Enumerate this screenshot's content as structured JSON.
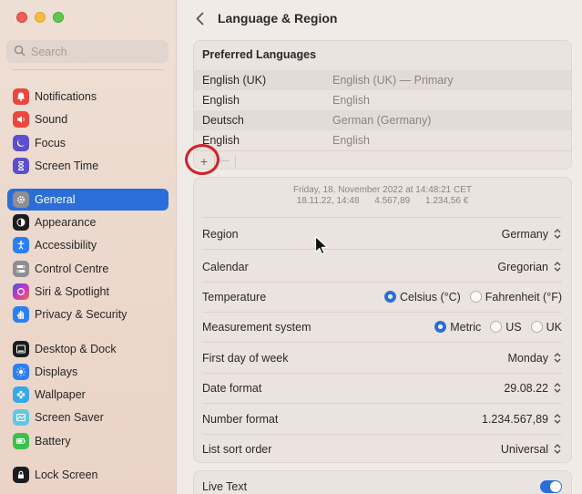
{
  "window": {
    "controls": [
      "close",
      "minimize",
      "zoom"
    ]
  },
  "search": {
    "placeholder": "Search"
  },
  "sidebar": {
    "items": [
      {
        "label": "Notifications",
        "icon": "bell-icon",
        "color": "#e9473f"
      },
      {
        "label": "Sound",
        "icon": "speaker-icon",
        "color": "#e9473f"
      },
      {
        "label": "Focus",
        "icon": "moon-icon",
        "color": "#5b4fcf"
      },
      {
        "label": "Screen Time",
        "icon": "hourglass-icon",
        "color": "#5b4fcf"
      },
      {
        "label": "General",
        "icon": "gear-icon",
        "color": "#8e8e93",
        "active": true
      },
      {
        "label": "Appearance",
        "icon": "appearance-icon",
        "color": "#1c1c1e"
      },
      {
        "label": "Accessibility",
        "icon": "accessibility-icon",
        "color": "#2b7ff6"
      },
      {
        "label": "Control Centre",
        "icon": "toggles-icon",
        "color": "#8e8e93"
      },
      {
        "label": "Siri & Spotlight",
        "icon": "siri-icon",
        "color": "#b03ad0"
      },
      {
        "label": "Privacy & Security",
        "icon": "hand-icon",
        "color": "#2b7ff6"
      },
      {
        "label": "Desktop & Dock",
        "icon": "dock-icon",
        "color": "#1c1c1e"
      },
      {
        "label": "Displays",
        "icon": "sun-icon",
        "color": "#2b7ff6"
      },
      {
        "label": "Wallpaper",
        "icon": "flower-icon",
        "color": "#38a8e8"
      },
      {
        "label": "Screen Saver",
        "icon": "screensaver-icon",
        "color": "#5ec7e4"
      },
      {
        "label": "Battery",
        "icon": "battery-icon",
        "color": "#3cc04c"
      },
      {
        "label": "Lock Screen",
        "icon": "lock-icon",
        "color": "#1c1c1e"
      }
    ]
  },
  "header": {
    "title": "Language & Region"
  },
  "languages": {
    "heading": "Preferred Languages",
    "rows": [
      {
        "name": "English (UK)",
        "detail": "English (UK) — Primary"
      },
      {
        "name": "English",
        "detail": "English"
      },
      {
        "name": "Deutsch",
        "detail": "German (Germany)"
      },
      {
        "name": "English",
        "detail": "English"
      }
    ],
    "add_label": "+",
    "remove_label": "—"
  },
  "preview": {
    "line1": "Friday, 18. November 2022 at 14:48:21 CET",
    "date": "18.11.22, 14:48",
    "number": "4.567,89",
    "currency": "1.234,56 €"
  },
  "settings": {
    "region": {
      "label": "Region",
      "value": "Germany"
    },
    "calendar": {
      "label": "Calendar",
      "value": "Gregorian"
    },
    "temperature": {
      "label": "Temperature",
      "options": [
        "Celsius (°C)",
        "Fahrenheit (°F)"
      ],
      "selected": "Celsius (°C)"
    },
    "measurement": {
      "label": "Measurement system",
      "options": [
        "Metric",
        "US",
        "UK"
      ],
      "selected": "Metric"
    },
    "first_day": {
      "label": "First day of week",
      "value": "Monday"
    },
    "date_format": {
      "label": "Date format",
      "value": "29.08.22"
    },
    "number_format": {
      "label": "Number format",
      "value": "1.234.567,89"
    },
    "sort_order": {
      "label": "List sort order",
      "value": "Universal"
    }
  },
  "live_text": {
    "label": "Live Text",
    "enabled": true
  },
  "colors": {
    "accent": "#2b6ed9",
    "highlight": "#d3202a"
  }
}
